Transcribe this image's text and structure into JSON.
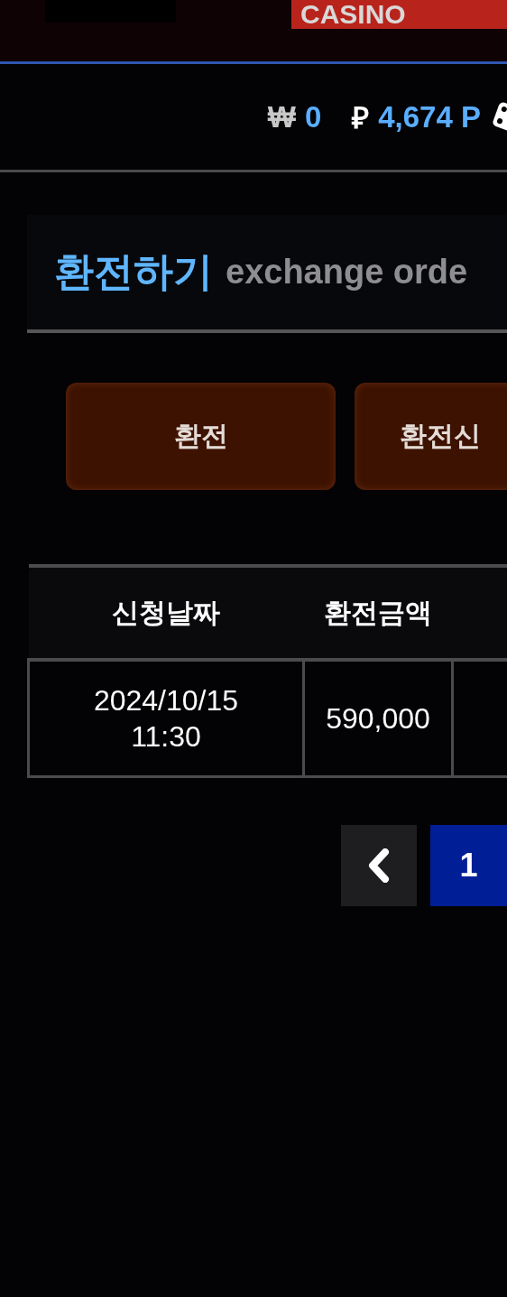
{
  "header": {
    "logo": "CASINO"
  },
  "balance": {
    "won_symbol": "₩",
    "won": "0",
    "point_symbol": "₽",
    "points": "4,674 P"
  },
  "heading": {
    "title": "환전하기",
    "subtitle": "exchange orde"
  },
  "tabs": [
    {
      "label": "환전",
      "selected": false
    },
    {
      "label": "환전신",
      "selected": false
    }
  ],
  "table": {
    "columns": [
      "신청날짜",
      "환전금액"
    ],
    "rows": [
      [
        "2024/10/15\n11:30",
        "590,000"
      ]
    ]
  },
  "pagination": {
    "pages": [
      {
        "label": "1",
        "selected": true
      }
    ]
  }
}
